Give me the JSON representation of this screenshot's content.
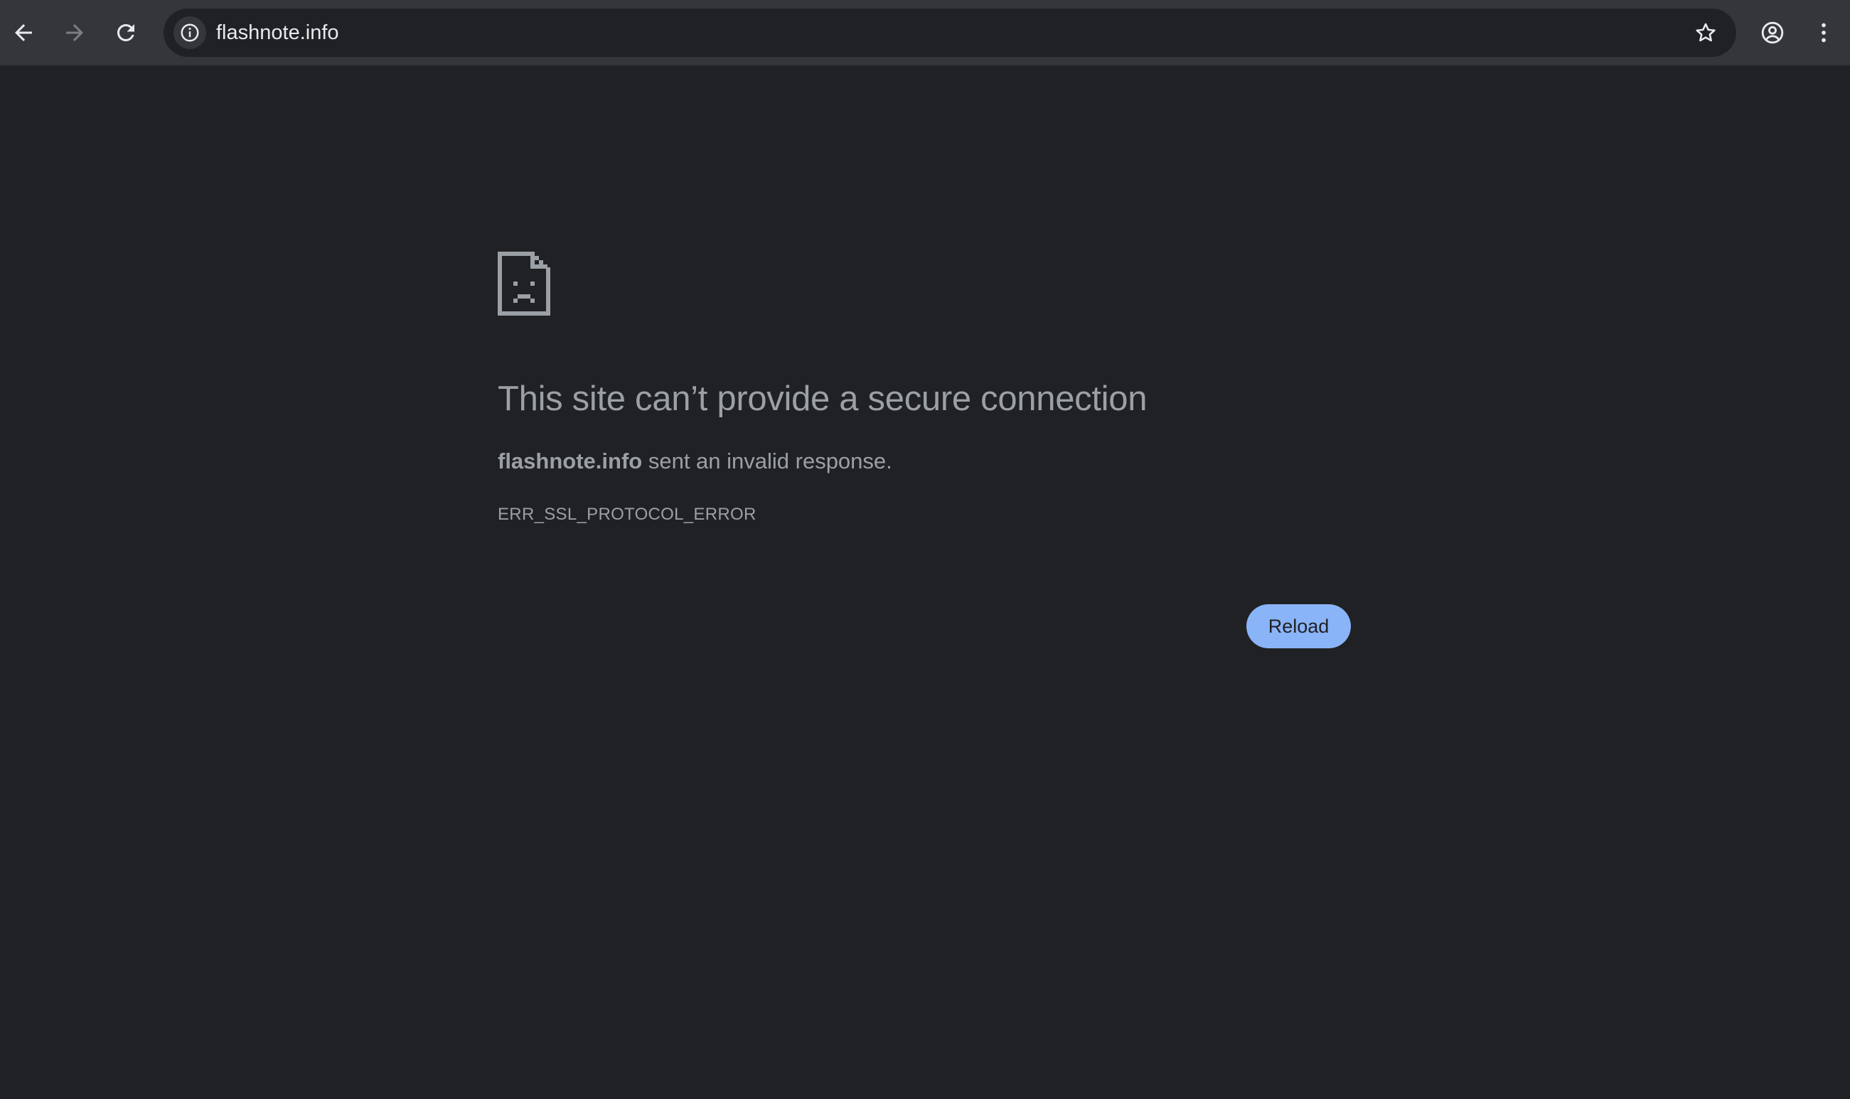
{
  "browser": {
    "url": "flashnote.info",
    "icons": {
      "back": "back-arrow-icon",
      "forward": "forward-arrow-icon",
      "reload": "reload-icon",
      "site_info": "info-icon",
      "bookmark": "star-icon",
      "profile": "profile-icon",
      "menu": "kebab-menu-icon"
    }
  },
  "error_page": {
    "icon": "sad-document-icon",
    "title": "This site can’t provide a secure connection",
    "host": "flashnote.info",
    "message": " sent an invalid response.",
    "error_code": "ERR_SSL_PROTOCOL_ERROR",
    "reload_label": "Reload"
  },
  "colors": {
    "background": "#202124",
    "toolbar": "#35363a",
    "text": "#9aa0a6",
    "button": "#8ab4f8"
  }
}
